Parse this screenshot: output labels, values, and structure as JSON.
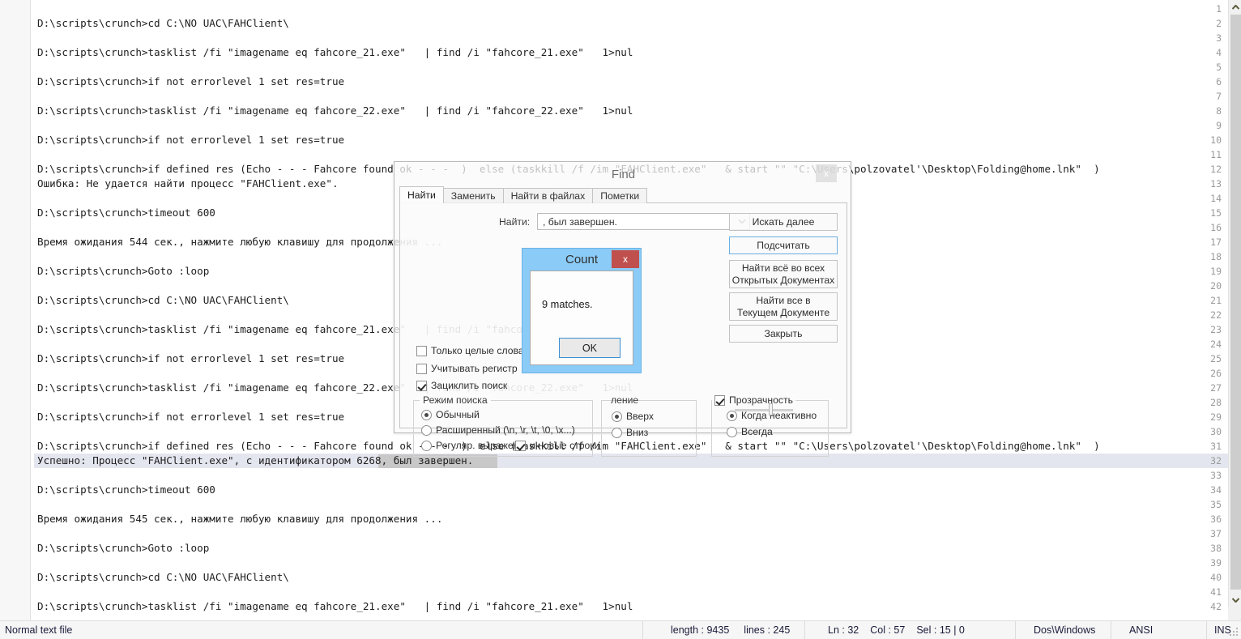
{
  "editor": {
    "first_line_number": 1,
    "current_line": 32,
    "selection_text": ", был завершен.",
    "lines": [
      {
        "n": 1,
        "text": ""
      },
      {
        "n": 2,
        "text": "D:\\scripts\\crunch>cd C:\\NO UAC\\FAHClient\\"
      },
      {
        "n": 3,
        "text": ""
      },
      {
        "n": 4,
        "text": "D:\\scripts\\crunch>tasklist /fi \"imagename eq fahcore_21.exe\"   | find /i \"fahcore_21.exe\"   1>nul"
      },
      {
        "n": 5,
        "text": ""
      },
      {
        "n": 6,
        "text": "D:\\scripts\\crunch>if not errorlevel 1 set res=true"
      },
      {
        "n": 7,
        "text": ""
      },
      {
        "n": 8,
        "text": "D:\\scripts\\crunch>tasklist /fi \"imagename eq fahcore_22.exe\"   | find /i \"fahcore_22.exe\"   1>nul"
      },
      {
        "n": 9,
        "text": ""
      },
      {
        "n": 10,
        "text": "D:\\scripts\\crunch>if not errorlevel 1 set res=true"
      },
      {
        "n": 11,
        "text": ""
      },
      {
        "n": 12,
        "text": "D:\\scripts\\crunch>if defined res (Echo - - - Fahcore found ok - - -  )  else (taskkill /f /im \"FAHClient.exe\"   & start \"\" \"C:\\Users\\polzovatel'\\Desktop\\Folding@home.lnk\"  )"
      },
      {
        "n": 13,
        "text": "Ошибка: Не удается найти процесс \"FAHClient.exe\"."
      },
      {
        "n": 14,
        "text": ""
      },
      {
        "n": 15,
        "text": "D:\\scripts\\crunch>timeout 600"
      },
      {
        "n": 16,
        "text": ""
      },
      {
        "n": 17,
        "text": "Время ожидания 544 сек., нажмите любую клавишу для продолжения ..."
      },
      {
        "n": 18,
        "text": ""
      },
      {
        "n": 19,
        "text": "D:\\scripts\\crunch>Goto :loop"
      },
      {
        "n": 20,
        "text": ""
      },
      {
        "n": 21,
        "text": "D:\\scripts\\crunch>cd C:\\NO UAC\\FAHClient\\"
      },
      {
        "n": 22,
        "text": ""
      },
      {
        "n": 23,
        "text": "D:\\scripts\\crunch>tasklist /fi \"imagename eq fahcore_21.exe\"   | find /i \"fahcore_21.exe\"   1>nul"
      },
      {
        "n": 24,
        "text": ""
      },
      {
        "n": 25,
        "text": "D:\\scripts\\crunch>if not errorlevel 1 set res=true"
      },
      {
        "n": 26,
        "text": ""
      },
      {
        "n": 27,
        "text": "D:\\scripts\\crunch>tasklist /fi \"imagename eq fahcore_22.exe\"   | find /i \"fahcore_22.exe\"   1>nul"
      },
      {
        "n": 28,
        "text": ""
      },
      {
        "n": 29,
        "text": "D:\\scripts\\crunch>if not errorlevel 1 set res=true"
      },
      {
        "n": 30,
        "text": ""
      },
      {
        "n": 31,
        "text": "D:\\scripts\\crunch>if defined res (Echo - - - Fahcore found ok - - -  )  else (taskkill /f /im \"FAHClient.exe\"   & start \"\" \"C:\\Users\\polzovatel'\\Desktop\\Folding@home.lnk\"  )"
      },
      {
        "n": 32,
        "text": "Успешно: Процесс \"FAHClient.exe\", с идентификатором 6268, был завершен."
      },
      {
        "n": 33,
        "text": ""
      },
      {
        "n": 34,
        "text": "D:\\scripts\\crunch>timeout 600"
      },
      {
        "n": 35,
        "text": ""
      },
      {
        "n": 36,
        "text": "Время ожидания 545 сек., нажмите любую клавишу для продолжения ..."
      },
      {
        "n": 37,
        "text": ""
      },
      {
        "n": 38,
        "text": "D:\\scripts\\crunch>Goto :loop"
      },
      {
        "n": 39,
        "text": ""
      },
      {
        "n": 40,
        "text": "D:\\scripts\\crunch>cd C:\\NO UAC\\FAHClient\\"
      },
      {
        "n": 41,
        "text": ""
      },
      {
        "n": 42,
        "text": "D:\\scripts\\crunch>tasklist /fi \"imagename eq fahcore_21.exe\"   | find /i \"fahcore_21.exe\"   1>nul"
      }
    ]
  },
  "scrollbar": {
    "up_arrow": "chevron-up-icon",
    "down_arrow": "chevron-down-icon"
  },
  "statusbar": {
    "doc_type": "Normal text file",
    "length": "length : 9435",
    "lines": "lines : 245",
    "ln": "Ln : 32",
    "col": "Col : 57",
    "sel": "Sel : 15 | 0",
    "eol": "Dos\\Windows",
    "encoding": "ANSI",
    "insert_mode": "INS"
  },
  "find_dialog": {
    "title": "Find",
    "close_label": "x",
    "tabs": [
      {
        "label": "Найти",
        "active": true
      },
      {
        "label": "Заменить",
        "active": false
      },
      {
        "label": "Найти в файлах",
        "active": false
      },
      {
        "label": "Пометки",
        "active": false
      }
    ],
    "find_label": "Найти:",
    "find_value": ", был завершен.",
    "find_placeholder": "",
    "buttons": [
      {
        "label": "Искать далее",
        "focus": false
      },
      {
        "label": "Подсчитать",
        "focus": true
      },
      {
        "label": "Найти всё во всех\nОткрытых Документах",
        "line1": "Найти всё во всех",
        "line2": "Открытых Документах",
        "focus": false
      },
      {
        "label": "Найти все в\nТекущем Документе",
        "line1": "Найти все в",
        "line2": "Текущем Документе",
        "focus": false
      },
      {
        "label": "Закрыть",
        "focus": false
      }
    ],
    "options": [
      {
        "label": "Только целые слова",
        "checked": false
      },
      {
        "label": "Учитывать регистр",
        "checked": false
      },
      {
        "label": "Зациклить поиск",
        "checked": true
      }
    ],
    "search_mode": {
      "title": "Режим поиска",
      "items": [
        {
          "label": "Обычный",
          "selected": true
        },
        {
          "label": "Расширенный (\\n, \\r, \\t, \\0, \\x...)",
          "selected": false
        },
        {
          "label": "Регуляр. выражен.",
          "selected": false
        }
      ],
      "newlines_label": "и новые строки",
      "newlines_checked": true
    },
    "direction": {
      "title": "Направление",
      "title_visible": "ление",
      "items": [
        {
          "label": "Вверх",
          "selected": true
        },
        {
          "label": "Вниз",
          "selected": false
        }
      ]
    },
    "transparency": {
      "label": "Прозрачность",
      "checked": true,
      "items": [
        {
          "label": "Когда неактивно",
          "selected": true
        },
        {
          "label": "Всегда",
          "selected": false
        }
      ],
      "slider_value": 58
    }
  },
  "count_dialog": {
    "title": "Count",
    "close_label": "x",
    "message": "9 matches.",
    "ok_label": "OK",
    "accent_color": "#8bcbf7",
    "close_color": "#c0504d"
  }
}
